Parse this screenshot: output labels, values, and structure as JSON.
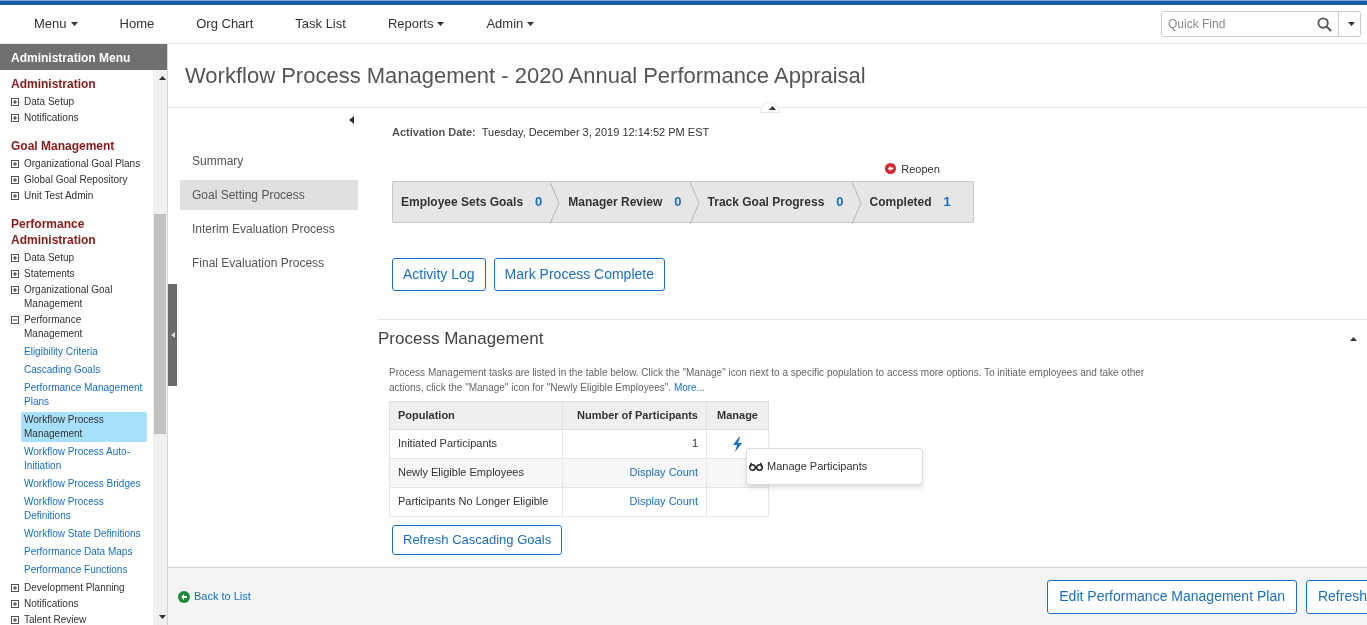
{
  "nav": {
    "items": [
      {
        "label": "Menu",
        "dropdown": true
      },
      {
        "label": "Home",
        "dropdown": false
      },
      {
        "label": "Org Chart",
        "dropdown": false
      },
      {
        "label": "Task List",
        "dropdown": false
      },
      {
        "label": "Reports",
        "dropdown": true
      },
      {
        "label": "Admin",
        "dropdown": true
      }
    ],
    "search": {
      "placeholder": "Quick Find"
    }
  },
  "sidebar": {
    "title": "Administration Menu",
    "sections": [
      {
        "heading": "Administration",
        "items": [
          {
            "label": "Data Setup",
            "expanded": false
          },
          {
            "label": "Notifications",
            "expanded": false
          }
        ]
      },
      {
        "heading": "Goal Management",
        "items": [
          {
            "label": "Organizational Goal Plans",
            "expanded": false
          },
          {
            "label": "Global Goal Repository",
            "expanded": false
          },
          {
            "label": "Unit Test Admin",
            "expanded": false
          }
        ]
      },
      {
        "heading": "Performance Administration",
        "items": [
          {
            "label": "Data Setup",
            "expanded": false
          },
          {
            "label": "Statements",
            "expanded": false
          },
          {
            "label": "Organizational Goal Management",
            "expanded": false
          },
          {
            "label": "Performance Management",
            "expanded": true,
            "children": [
              {
                "label": "Eligibility Criteria",
                "selected": false
              },
              {
                "label": "Cascading Goals",
                "selected": false
              },
              {
                "label": "Performance Management Plans",
                "selected": false
              },
              {
                "label": "Workflow Process Management",
                "selected": true
              },
              {
                "label": "Workflow Process Auto-Initiation",
                "selected": false
              },
              {
                "label": "Workflow Process Bridges",
                "selected": false
              },
              {
                "label": "Workflow Process Definitions",
                "selected": false
              },
              {
                "label": "Workflow State Definitions",
                "selected": false
              },
              {
                "label": "Performance Data Maps",
                "selected": false
              },
              {
                "label": "Performance Functions",
                "selected": false
              }
            ]
          },
          {
            "label": "Development Planning",
            "expanded": false
          },
          {
            "label": "Notifications",
            "expanded": false
          },
          {
            "label": "Talent Review",
            "expanded": false
          }
        ]
      }
    ]
  },
  "page": {
    "title": "Workflow Process Management - 2020 Annual Performance Appraisal",
    "subnav": [
      {
        "label": "Summary",
        "selected": false
      },
      {
        "label": "Goal Setting Process",
        "selected": true
      },
      {
        "label": "Interim Evaluation Process",
        "selected": false
      },
      {
        "label": "Final Evaluation Process",
        "selected": false
      }
    ],
    "activation": {
      "label": "Activation Date:",
      "value": "Tuesday, December 3, 2019 12:14:52 PM EST"
    },
    "reopen": "Reopen",
    "steps": [
      {
        "label": "Employee Sets Goals",
        "count": "0"
      },
      {
        "label": "Manager Review",
        "count": "0"
      },
      {
        "label": "Track Goal Progress",
        "count": "0"
      },
      {
        "label": "Completed",
        "count": "1"
      }
    ],
    "buttons": [
      "Activity Log",
      "Mark Process Complete"
    ],
    "process": {
      "title": "Process Management",
      "expanded": true,
      "description": "Process Management tasks are listed in the table below. Click the \"Manage\" icon next to a specific population to access more options. To initiate employees and take other actions, click the \"Manage\" icon for \"Newly Eligible Employees\".",
      "more": "More...",
      "columns": [
        "Population",
        "Number of Participants",
        "Manage"
      ],
      "rows": [
        {
          "population": "Initiated Participants",
          "participants": "1",
          "kind": "count",
          "manage": true
        },
        {
          "population": "Newly Eligible Employees",
          "participants": "Display Count",
          "kind": "link",
          "manage": false
        },
        {
          "population": "Participants No Longer Eligible",
          "participants": "Display Count",
          "kind": "link",
          "manage": false
        }
      ],
      "menu": [
        "Manage Participants"
      ],
      "refresh_button": "Refresh Cascading Goals"
    }
  },
  "footer": {
    "back": "Back to List",
    "buttons": [
      "Edit Performance Management Plan",
      "Refresh"
    ]
  }
}
